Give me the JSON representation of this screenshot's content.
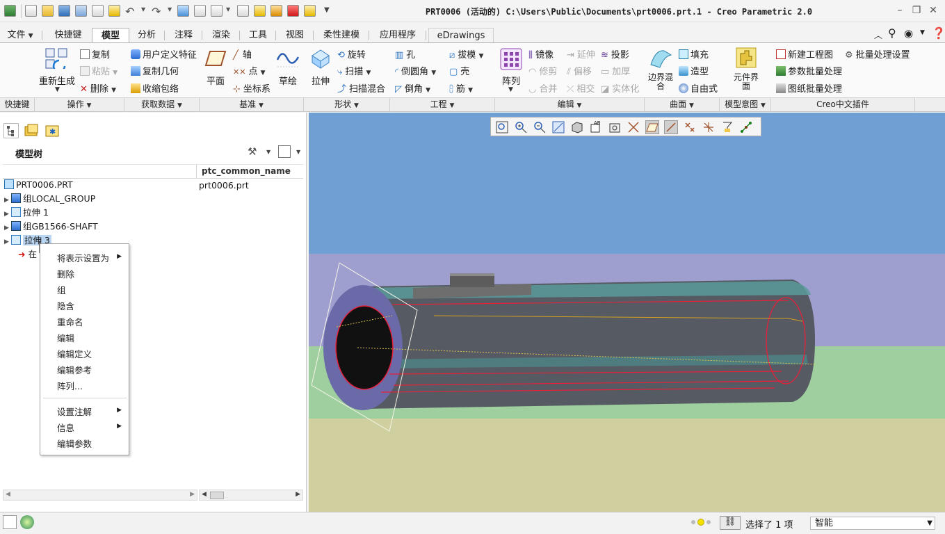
{
  "window": {
    "title": "PRT0006 (活动的) C:\\Users\\Public\\Documents\\prt0006.prt.1 - Creo Parametric 2.0"
  },
  "tabs": [
    {
      "label": "文件",
      "active": false
    },
    {
      "label": "快捷键",
      "active": false
    },
    {
      "label": "模型",
      "active": true
    },
    {
      "label": "分析",
      "active": false
    },
    {
      "label": "注释",
      "active": false
    },
    {
      "label": "渲染",
      "active": false
    },
    {
      "label": "工具",
      "active": false
    },
    {
      "label": "视图",
      "active": false
    },
    {
      "label": "柔性建模",
      "active": false
    },
    {
      "label": "应用程序",
      "active": false
    },
    {
      "label": "eDrawings",
      "active": false
    }
  ],
  "ribbon": {
    "regenerate": "重新生成",
    "copy": "复制",
    "paste": "粘贴",
    "delete": "删除",
    "udf": "用户定义特征",
    "copy_geom": "复制几何",
    "shrinkwrap": "收缩包络",
    "plane": "平面",
    "axis": "轴",
    "point": "点",
    "csys": "坐标系",
    "sketch": "草绘",
    "extrude": "拉伸",
    "revolve": "旋转",
    "sweep": "扫描",
    "swept_blend": "扫描混合",
    "hole": "孔",
    "round": "倒圆角",
    "chamfer": "倒角",
    "draft": "拔模",
    "shell": "壳",
    "rib": "筋",
    "pattern": "阵列",
    "mirror": "镜像",
    "trim": "修剪",
    "merge": "合并",
    "extend": "延伸",
    "offset": "偏移",
    "intersect": "相交",
    "project": "投影",
    "thicken": "加厚",
    "solidify": "实体化",
    "boundary_blend": "边界混合",
    "fill": "填充",
    "style": "造型",
    "freestyle": "自由式",
    "component_interface": "元件界面",
    "new_drawing": "新建工程图",
    "batch_settings": "批量处理设置",
    "param_batch": "参数批量处理",
    "drawing_batch": "图纸批量处理"
  },
  "groups": [
    {
      "label": "快捷键",
      "dropdown": false
    },
    {
      "label": "操作",
      "dropdown": true
    },
    {
      "label": "获取数据",
      "dropdown": true
    },
    {
      "label": "基准",
      "dropdown": true
    },
    {
      "label": "形状",
      "dropdown": true
    },
    {
      "label": "工程",
      "dropdown": true
    },
    {
      "label": "编辑",
      "dropdown": true
    },
    {
      "label": "曲面",
      "dropdown": true
    },
    {
      "label": "模型意图",
      "dropdown": true
    },
    {
      "label": "Creo中文插件",
      "dropdown": false
    }
  ],
  "model_tree": {
    "header": "模型树",
    "column": "ptc_common_name",
    "rows": [
      {
        "label": "PRT0006.PRT",
        "common": "prt0006.prt"
      },
      {
        "label": "组LOCAL_GROUP",
        "common": ""
      },
      {
        "label": "拉伸 1",
        "common": ""
      },
      {
        "label": "组GB1566-SHAFT",
        "common": ""
      },
      {
        "label": "拉伸 3",
        "common": ""
      },
      {
        "label": "在",
        "common": ""
      }
    ]
  },
  "context_menu": {
    "items": [
      {
        "label": "将表示设置为",
        "submenu": true
      },
      {
        "label": "删除",
        "submenu": false
      },
      {
        "label": "组",
        "submenu": false
      },
      {
        "label": "隐含",
        "submenu": false
      },
      {
        "label": "重命名",
        "submenu": false
      },
      {
        "label": "编辑",
        "submenu": false
      },
      {
        "label": "编辑定义",
        "submenu": false
      },
      {
        "label": "编辑参考",
        "submenu": false
      },
      {
        "label": "阵列...",
        "submenu": false
      },
      {
        "label": "设置注解",
        "submenu": true
      },
      {
        "label": "信息",
        "submenu": true
      },
      {
        "label": "编辑参数",
        "submenu": false
      }
    ]
  },
  "status": {
    "selected": "选择了 1 项",
    "filter": "智能"
  },
  "colors": {
    "sky": "#6f9fd3",
    "horizon": "#9f9fcf",
    "grass": "#9fcf9f",
    "floor": "#cfcf9f",
    "edge_highlight": "#e8203a",
    "selection": "#b9d5f2"
  }
}
